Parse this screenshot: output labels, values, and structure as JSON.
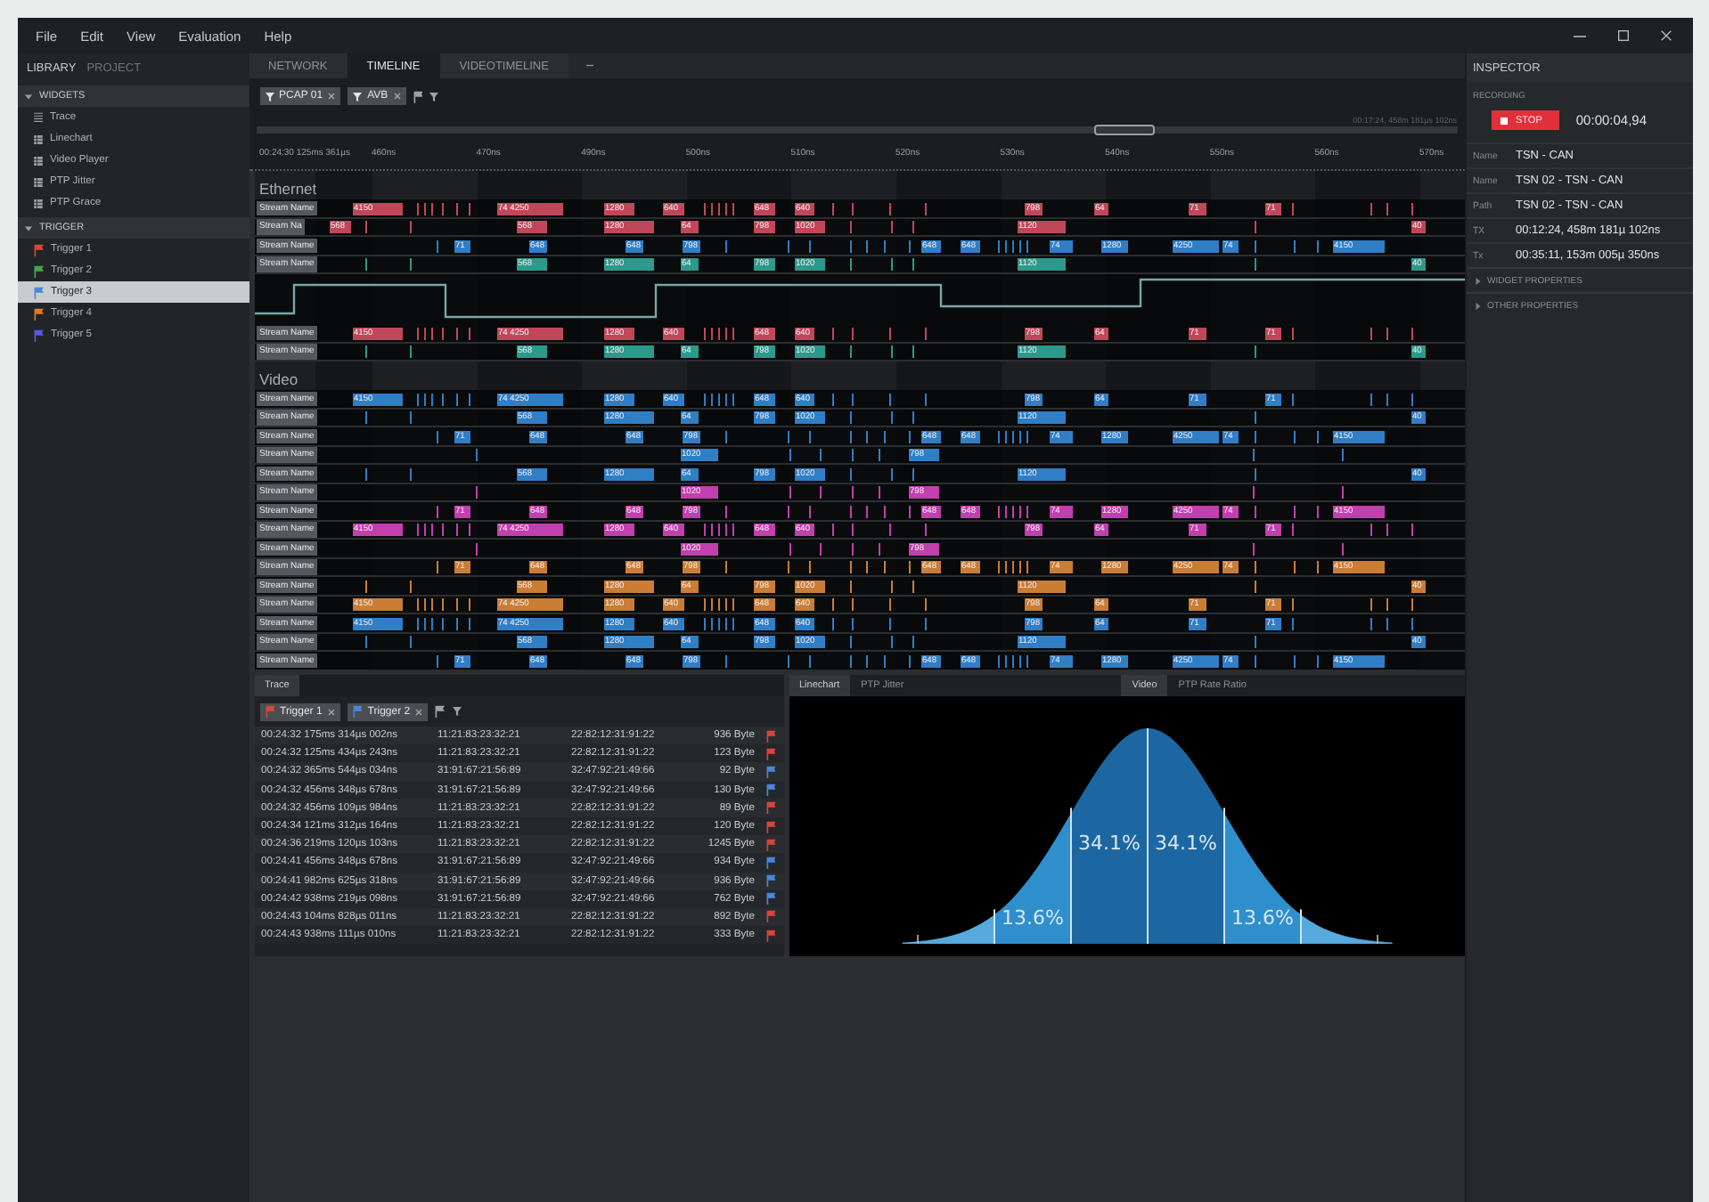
{
  "menu": [
    "File",
    "Edit",
    "View",
    "Evaluation",
    "Help"
  ],
  "sidebar": {
    "tabs": [
      {
        "label": "LIBRARY",
        "selected": true
      },
      {
        "label": "PROJECT",
        "selected": false
      }
    ],
    "sections": [
      {
        "title": "WIDGETS",
        "expanded": true,
        "items": [
          {
            "label": "Trace",
            "kind": "list",
            "selected": false
          },
          {
            "label": "Linechart",
            "kind": "grid",
            "selected": false
          },
          {
            "label": "Video Player",
            "kind": "grid",
            "selected": false
          },
          {
            "label": "PTP Jitter",
            "kind": "grid",
            "selected": false
          },
          {
            "label": "PTP Grace",
            "kind": "grid",
            "selected": false
          }
        ]
      },
      {
        "title": "TRIGGER",
        "expanded": true,
        "items": [
          {
            "label": "Trigger 1",
            "kind": "trigger",
            "color": "#d9443c",
            "selected": false
          },
          {
            "label": "Trigger 2",
            "kind": "trigger",
            "color": "#3fae4a",
            "selected": false
          },
          {
            "label": "Trigger 3",
            "kind": "trigger",
            "color": "#4a86d8",
            "selected": true
          },
          {
            "label": "Trigger 4",
            "kind": "trigger",
            "color": "#e07a2a",
            "selected": false
          },
          {
            "label": "Trigger 5",
            "kind": "trigger",
            "color": "#5a5ae0",
            "selected": false
          }
        ]
      }
    ]
  },
  "tabs": [
    {
      "label": "NETWORK",
      "selected": false
    },
    {
      "label": "TIMELINE",
      "selected": true
    },
    {
      "label": "VIDEOTIMELINE",
      "selected": false
    }
  ],
  "filters": [
    {
      "label": "PCAP 01"
    },
    {
      "label": "AVB"
    }
  ],
  "overview": {
    "time": "00:17:24, 458m 181µs 102ns"
  },
  "ruler": {
    "start": "00:24:30 125ms 361µs",
    "ticks": [
      "460ns",
      "470ns",
      "490ns",
      "500ns",
      "510ns",
      "520ns",
      "530ns",
      "540ns",
      "550ns",
      "560ns",
      "570ns"
    ]
  },
  "groups": [
    {
      "title": "Ethernet",
      "lanes": [
        {
          "kind": "burst",
          "name": "Stream Name",
          "color": "#c0475a",
          "segments": [
            "4150",
            "74 4250",
            "1280",
            "640",
            "648",
            "640",
            "798",
            "64",
            "71",
            "71"
          ]
        },
        {
          "kind": "sparse",
          "name": "Stream Na",
          "color": "#c0475a",
          "segments": [
            "568",
            "568",
            "1280",
            "64",
            "798",
            "1020",
            "1120",
            "40"
          ]
        },
        {
          "kind": "dense",
          "name": "Stream Name",
          "color": "#2f7ec6",
          "segments": [
            "71",
            "648",
            "648",
            "798",
            "648",
            "648",
            "74",
            "1280",
            "4250",
            "74",
            "4150"
          ]
        },
        {
          "kind": "sparse",
          "name": "Stream Name",
          "color": "#2b9a8c",
          "segments": [
            "568",
            "1280",
            "64",
            "798",
            "1020",
            "1120",
            "40"
          ]
        },
        {
          "kind": "signal"
        },
        {
          "kind": "burst",
          "name": "Stream Name",
          "color": "#c0475a",
          "segments": [
            "4150",
            "74 4250",
            "1280",
            "640",
            "648",
            "640",
            "798",
            "64",
            "71",
            "71"
          ]
        },
        {
          "kind": "sparse",
          "name": "Stream Name",
          "color": "#2b9a8c",
          "segments": [
            "568",
            "1280",
            "64",
            "798",
            "1020",
            "1120",
            "40"
          ]
        }
      ]
    },
    {
      "title": "Video",
      "lanes": [
        {
          "kind": "burst",
          "name": "Stream Name",
          "color": "#2f7ec6",
          "segments": [
            "4150",
            "74 4250",
            "1280",
            "640",
            "648",
            "640",
            "798",
            "64",
            "71",
            "71"
          ]
        },
        {
          "kind": "sparse",
          "name": "Stream Name",
          "color": "#2f7ec6",
          "segments": [
            "568",
            "1280",
            "64",
            "798",
            "1020",
            "1120",
            "40"
          ]
        },
        {
          "kind": "dense",
          "name": "Stream Name",
          "color": "#2f7ec6",
          "segments": [
            "71",
            "648",
            "648",
            "798",
            "648",
            "648",
            "74",
            "1280",
            "4250",
            "74",
            "4150"
          ]
        },
        {
          "kind": "rare",
          "name": "Stream Name",
          "color": "#2f7ec6",
          "segments": [
            "1020",
            "798"
          ]
        },
        {
          "kind": "sparse",
          "name": "Stream Name",
          "color": "#2f7ec6",
          "segments": [
            "568",
            "1280",
            "64",
            "798",
            "1020",
            "1120",
            "40"
          ]
        },
        {
          "kind": "rare",
          "name": "Stream Name",
          "color": "#c23fae",
          "segments": [
            "1020",
            "798"
          ]
        },
        {
          "kind": "dense",
          "name": "Stream Name",
          "color": "#c23fae",
          "segments": [
            "71",
            "648",
            "648",
            "798",
            "648",
            "648",
            "74",
            "1280",
            "4250",
            "74",
            "4150"
          ]
        },
        {
          "kind": "burst",
          "name": "Stream Name",
          "color": "#c23fae",
          "segments": [
            "4150",
            "74 4250",
            "1280",
            "640",
            "648",
            "640",
            "798",
            "64",
            "71",
            "71"
          ]
        },
        {
          "kind": "rare",
          "name": "Stream Name",
          "color": "#c23fae",
          "segments": [
            "1020",
            "798"
          ]
        },
        {
          "kind": "dense",
          "name": "Stream Name",
          "color": "#c97d35",
          "segments": [
            "71",
            "648",
            "648",
            "798",
            "648",
            "648",
            "74",
            "1280",
            "4250",
            "74",
            "4150"
          ]
        },
        {
          "kind": "sparse",
          "name": "Stream Name",
          "color": "#c97d35",
          "segments": [
            "568",
            "1280",
            "64",
            "798",
            "1020",
            "1120",
            "40"
          ]
        },
        {
          "kind": "burst",
          "name": "Stream Name",
          "color": "#c97d35",
          "segments": [
            "4150",
            "74 4250",
            "1280",
            "640",
            "648",
            "640",
            "798",
            "64",
            "71",
            "71"
          ]
        },
        {
          "kind": "burst",
          "name": "Stream Name",
          "color": "#2f7ec6",
          "segments": [
            "4150",
            "74 4250",
            "1280",
            "640",
            "648",
            "640",
            "798",
            "64",
            "71",
            "71"
          ]
        },
        {
          "kind": "sparse",
          "name": "Stream Name",
          "color": "#2f7ec6",
          "segments": [
            "568",
            "1280",
            "64",
            "798",
            "1020",
            "1120",
            "40"
          ]
        },
        {
          "kind": "dense",
          "name": "Stream Name",
          "color": "#2f7ec6",
          "segments": [
            "71",
            "648",
            "648",
            "798",
            "648",
            "648",
            "74",
            "1280",
            "4250",
            "74",
            "4150"
          ]
        }
      ]
    }
  ],
  "trace": {
    "tab": "Trace",
    "filters": [
      {
        "label": "Trigger 1",
        "color": "#d9443c"
      },
      {
        "label": "Trigger 2",
        "color": "#4a86d8"
      }
    ],
    "rows": [
      {
        "time": "00:24:32 175ms 314µs 002ns",
        "source": "11:21:83:23:32:21",
        "destination": "22:82:12:31:91:22",
        "size": "936 Byte",
        "color": "#d9443c"
      },
      {
        "time": "00:24:32 125ms 434µs 243ns",
        "source": "11:21:83:23:32:21",
        "destination": "22:82:12:31:91:22",
        "size": "123 Byte",
        "color": "#d9443c"
      },
      {
        "time": "00:24:32 365ms 544µs 034ns",
        "source": "31:91:67:21:56:89",
        "destination": "32:47:92:21:49:66",
        "size": "92 Byte",
        "color": "#4a86d8"
      },
      {
        "time": "00:24:32 456ms 348µs 678ns",
        "source": "31:91:67:21:56:89",
        "destination": "32:47:92:21:49:66",
        "size": "130 Byte",
        "color": "#4a86d8"
      },
      {
        "time": "00:24:32 456ms 109µs 984ns",
        "source": "11:21:83:23:32:21",
        "destination": "22:82:12:31:91:22",
        "size": "89 Byte",
        "color": "#d9443c"
      },
      {
        "time": "00:24:34 121ms 312µs 164ns",
        "source": "11:21:83:23:32:21",
        "destination": "22:82:12:31:91:22",
        "size": "120 Byte",
        "color": "#d9443c"
      },
      {
        "time": "00:24:36 219ms 120µs 103ns",
        "source": "11:21:83:23:32:21",
        "destination": "22:82:12:31:91:22",
        "size": "1245 Byte",
        "color": "#d9443c"
      },
      {
        "time": "00:24:41 456ms 348µs 678ns",
        "source": "31:91:67:21:56:89",
        "destination": "32:47:92:21:49:66",
        "size": "934 Byte",
        "color": "#4a86d8"
      },
      {
        "time": "00:24:41 982ms 625µs 318ns",
        "source": "31:91:67:21:56:89",
        "destination": "32:47:92:21:49:66",
        "size": "936 Byte",
        "color": "#4a86d8"
      },
      {
        "time": "00:24:42 938ms 219µs 098ns",
        "source": "31:91:67:21:56:89",
        "destination": "32:47:92:21:49:66",
        "size": "762 Byte",
        "color": "#4a86d8"
      },
      {
        "time": "00:24:43 104ms 828µs 011ns",
        "source": "11:21:83:23:32:21",
        "destination": "22:82:12:31:91:22",
        "size": "892 Byte",
        "color": "#d9443c"
      },
      {
        "time": "00:24:43 938ms 111µs 010ns",
        "source": "11:21:83:23:32:21",
        "destination": "22:82:12:31:91:22",
        "size": "333 Byte",
        "color": "#d9443c"
      }
    ]
  },
  "chart_panel": {
    "tabs": [
      {
        "label": "Linechart",
        "selected": true
      },
      {
        "label": "PTP Jitter",
        "selected": false
      }
    ],
    "tabs_2": [
      {
        "label": "Video",
        "selected": true
      },
      {
        "label": "PTP Rate Ratio",
        "selected": false
      }
    ],
    "bands": [
      {
        "label": "13.6%"
      },
      {
        "label": "34.1%"
      },
      {
        "label": "34.1%"
      },
      {
        "label": "13.6%"
      }
    ]
  },
  "inspector": {
    "title": "INSPECTOR",
    "section": "RECORDING",
    "stop_button": "STOP",
    "timer": "00:00:04,94",
    "properties": [
      {
        "key": "Name",
        "value": "TSN - CAN"
      },
      {
        "key": "Name",
        "value": "TSN 02 - TSN - CAN"
      },
      {
        "key": "Path",
        "value": "TSN 02 - TSN - CAN"
      },
      {
        "key": "TX",
        "value": "00:12:24, 458m 181µ 102ns"
      },
      {
        "key": "Tx",
        "value": "00:35:11, 153m 005µ 350ns"
      }
    ],
    "panels": [
      {
        "title": "WIDGET PROPERTIES",
        "expanded": false
      },
      {
        "title": "OTHER PROPERTIES",
        "expanded": false
      }
    ]
  }
}
